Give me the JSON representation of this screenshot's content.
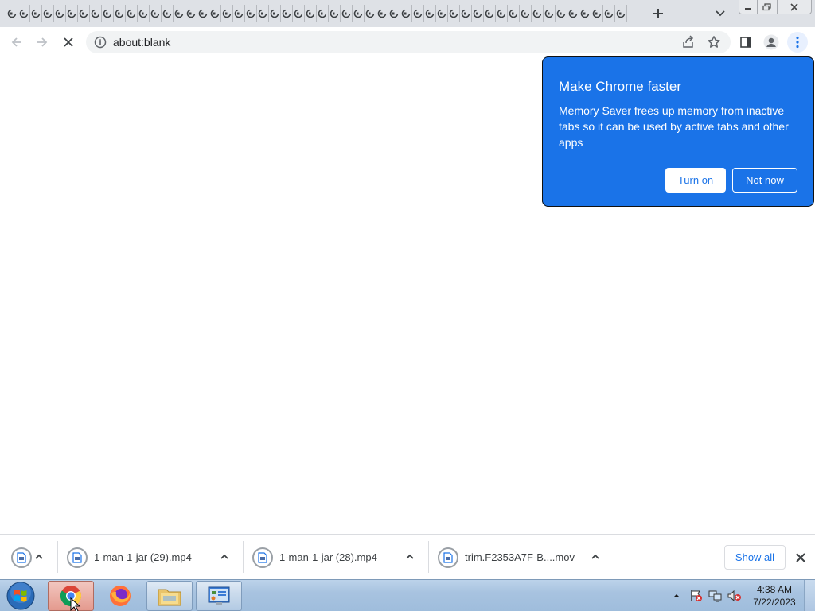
{
  "browser": {
    "tab_count": 52,
    "tab_favicon": "page-loading-icon",
    "window_controls": [
      "minimize",
      "maximize",
      "close"
    ],
    "address_bar": {
      "url": "about:blank",
      "security_icon": "info-icon"
    },
    "toolbar_icons": [
      "back-icon",
      "forward-icon",
      "stop-icon",
      "share-icon",
      "star-icon",
      "side-panel-icon",
      "profile-icon",
      "menu-icon"
    ]
  },
  "popup": {
    "title": "Make Chrome faster",
    "body": "Memory Saver frees up memory from inactive tabs so it can be used by active tabs and other apps",
    "turn_on_label": "Turn on",
    "not_now_label": "Not now",
    "accent_color": "#1a73e8"
  },
  "downloads": {
    "items": [
      {
        "name": "1-man-1-jar (29).mp4"
      },
      {
        "name": "1-man-1-jar (28).mp4"
      },
      {
        "name": "trim.F2353A7F-B....mov"
      }
    ],
    "show_all_label": "Show all"
  },
  "taskbar": {
    "apps": [
      "chrome-icon",
      "firefox-icon",
      "file-explorer-icon",
      "control-panel-icon"
    ],
    "clock": {
      "time": "4:38 AM",
      "date": "7/22/2023"
    }
  }
}
